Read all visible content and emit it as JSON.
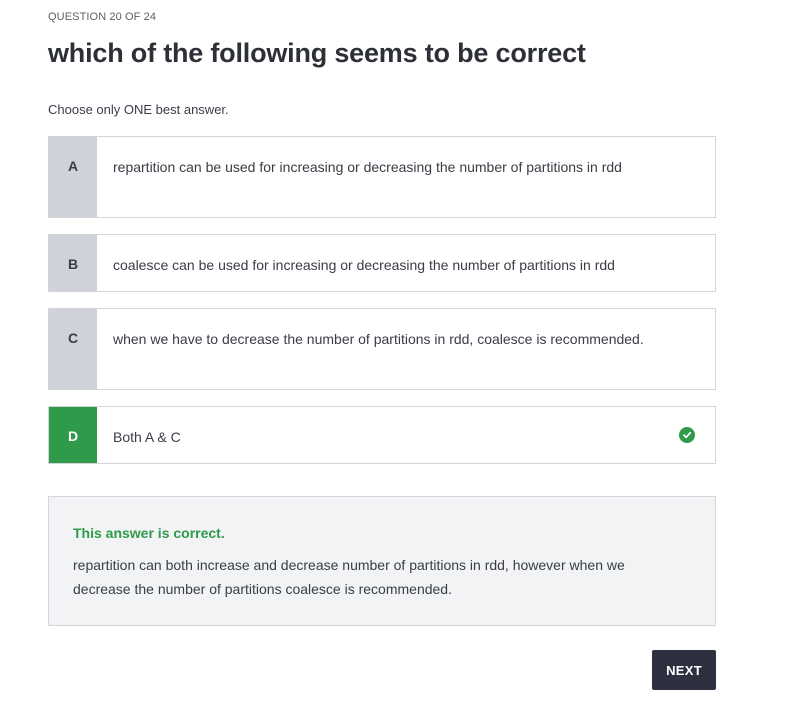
{
  "quiz": {
    "counter": "QUESTION 20 OF 24",
    "title": "which of the following seems to be correct",
    "instruction": "Choose only ONE best answer.",
    "options": [
      {
        "letter": "A",
        "text": "repartition can be used for increasing or decreasing the number of partitions in rdd"
      },
      {
        "letter": "B",
        "text": "coalesce can be used for increasing or decreasing the number of partitions in rdd"
      },
      {
        "letter": "C",
        "text": "when we have to decrease the number of partitions in rdd, coalesce is recommended."
      },
      {
        "letter": "D",
        "text": "Both A & C"
      }
    ],
    "selected_option": "D",
    "feedback": {
      "title": "This answer is correct.",
      "text": "repartition can both increase and decrease number of partitions in rdd, however when we decrease the number of partitions coalesce is recommended."
    },
    "next_label": "NEXT"
  },
  "colors": {
    "correct": "#2f9a4a",
    "letter_bg": "#d0d2d9",
    "next_bg": "#2e3040",
    "feedback_bg": "#f2f3f5"
  },
  "icons": {
    "selected_indicator": "check-circle-icon"
  }
}
